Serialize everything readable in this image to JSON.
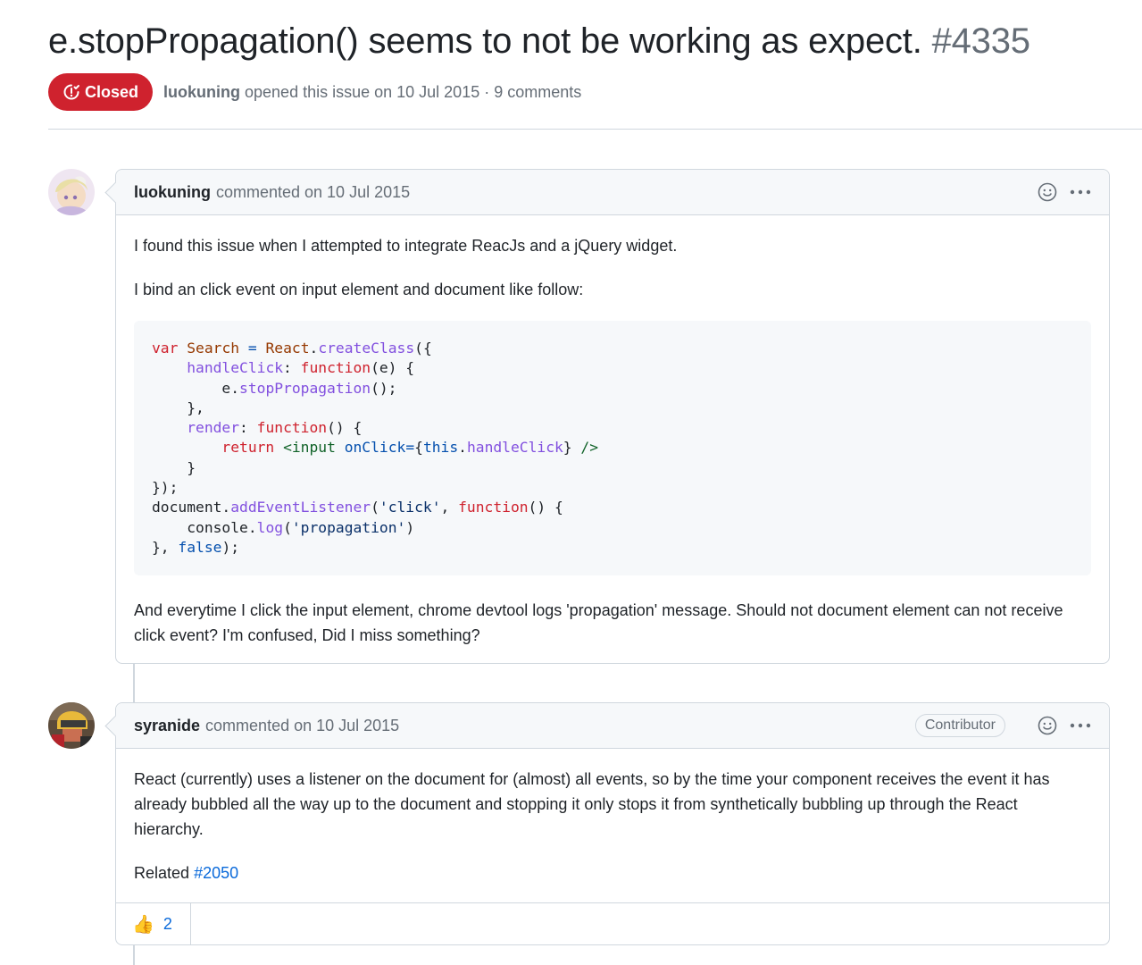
{
  "issue": {
    "title": "e.stopPropagation() seems to not be working as expect.",
    "number": "#4335",
    "state": "Closed",
    "state_color": "#cf222e",
    "author": "luokuning",
    "opened_text": "opened this issue on 10 Jul 2015 · 9 comments"
  },
  "comments": [
    {
      "author": "luokuning",
      "meta": "commented on 10 Jul 2015",
      "avatar_icon": "anime-avatar",
      "paragraphs": [
        "I found this issue when I attempted to integrate ReacJs and a jQuery widget.",
        "I bind an click event on input element and document like follow:"
      ],
      "code_lines": [
        "var Search = React.createClass({",
        "    handleClick: function(e) {",
        "        e.stopPropagation();",
        "    },",
        "    render: function() {",
        "        return <input onClick={this.handleClick} />",
        "    }",
        "});",
        "document.addEventListener('click', function() {",
        "    console.log('propagation')",
        "}, false);"
      ],
      "closing": "And everytime I click the input element, chrome devtool logs 'propagation' message. Should not document element can not receive click event? I'm confused, Did I miss something?"
    },
    {
      "author": "syranide",
      "meta": "commented on 10 Jul 2015",
      "role": "Contributor",
      "avatar_icon": "helmet-avatar",
      "body": "React (currently) uses a listener on the document for (almost) all events, so by the time your component receives the event it has already bubbled all the way up to the document and stopping it only stops it from synthetically bubbling up through the React hierarchy.",
      "related_label": "Related",
      "related_link": "#2050",
      "reaction_emoji": "👍",
      "reaction_count": "2"
    }
  ],
  "icons": [
    "issue-closed-icon",
    "smiley-icon",
    "kebab-icon",
    "thumbs-up-icon"
  ],
  "colors": {
    "link": "#0969da",
    "muted": "#656d76",
    "border": "#d0d7de",
    "header_bg": "#f6f8fa"
  }
}
